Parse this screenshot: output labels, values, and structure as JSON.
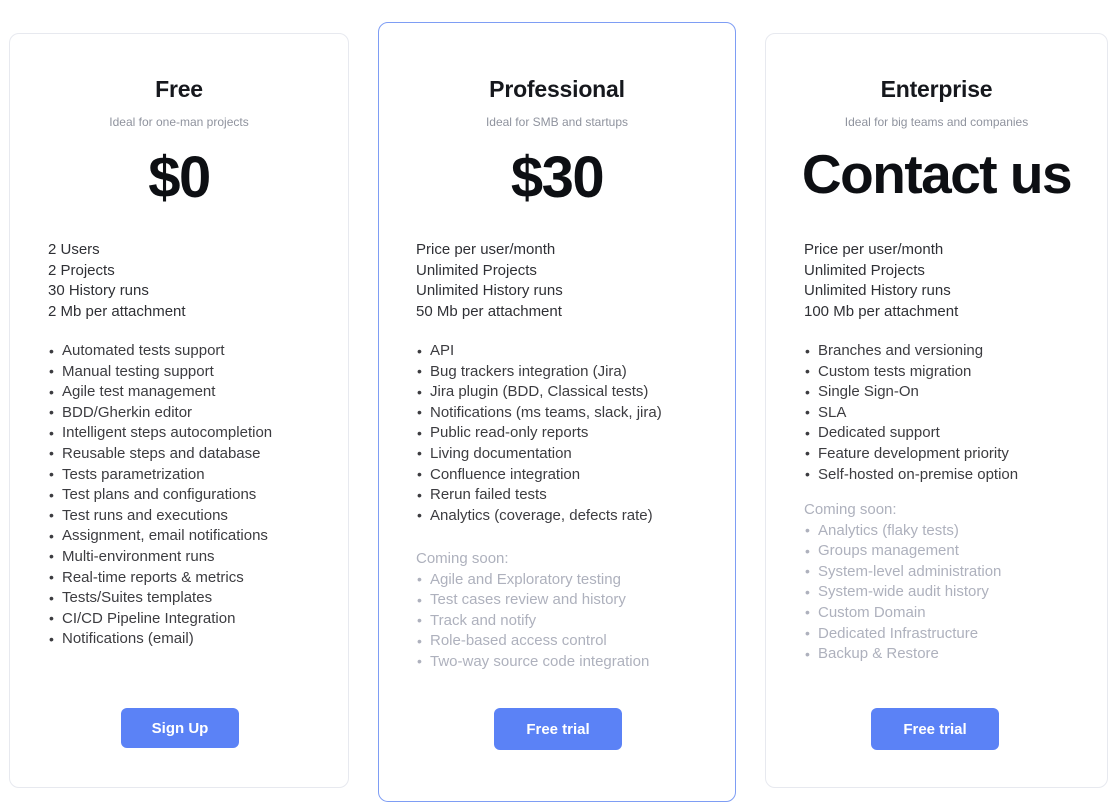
{
  "theme": {
    "page_background": "#ffffff",
    "card_border": "#e7e9ef",
    "highlight_card_border": "#7e9df4",
    "cta_background": "#5b82f6",
    "cta_text": "#ffffff",
    "primary_text": "#16181d",
    "body_text": "#3c3c40",
    "muted_text": "#8f939e",
    "coming_soon_text": "#aeb1bd"
  },
  "plans": [
    {
      "id": "free",
      "name": "Free",
      "tagline": "Ideal for one-man projects",
      "price": "$0",
      "highlighted": false,
      "specs": [
        "2 Users",
        "2 Projects",
        "30 History runs",
        "2 Mb per attachment"
      ],
      "features": [
        "Automated tests support",
        "Manual testing support",
        "Agile test management",
        "BDD/Gherkin editor",
        "Intelligent steps autocompletion",
        "Reusable steps and database",
        "Tests parametrization",
        "Test plans and configurations",
        "Test runs and executions",
        "Assignment, email notifications",
        "Multi-environment runs",
        "Real-time reports & metrics",
        "Tests/Suites templates",
        "CI/CD Pipeline Integration",
        "Notifications (email)"
      ],
      "coming_soon_title": "",
      "coming_soon": [],
      "cta_label": "Sign Up"
    },
    {
      "id": "professional",
      "name": "Professional",
      "tagline": "Ideal for SMB and startups",
      "price": "$30",
      "highlighted": true,
      "specs": [
        "Price per user/month",
        "Unlimited Projects",
        "Unlimited History runs",
        "50 Mb per attachment"
      ],
      "features": [
        "API",
        "Bug trackers integration (Jira)",
        "Jira plugin (BDD, Classical tests)",
        "Notifications (ms teams, slack, jira)",
        "Public read-only reports",
        "Living documentation",
        "Confluence integration",
        "Rerun failed tests",
        "Analytics (coverage, defects rate)"
      ],
      "coming_soon_title": "Coming soon:",
      "coming_soon": [
        "Agile and Exploratory testing",
        "Test cases review and history",
        "Track and notify",
        "Role-based access control",
        "Two-way source code integration"
      ],
      "cta_label": "Free trial"
    },
    {
      "id": "enterprise",
      "name": "Enterprise",
      "tagline": "Ideal for big teams and companies",
      "price": "Contact us",
      "highlighted": false,
      "specs": [
        "Price per user/month",
        "Unlimited Projects",
        "Unlimited History runs",
        "100 Mb per attachment"
      ],
      "features": [
        "Branches and versioning",
        "Custom tests migration",
        "Single Sign-On",
        "SLA",
        "Dedicated support",
        "Feature development priority",
        "Self-hosted on-premise option"
      ],
      "coming_soon_title": "Coming soon:",
      "coming_soon": [
        "Analytics (flaky tests)",
        "Groups management",
        "System-level administration",
        "System-wide audit history",
        "Custom Domain",
        "Dedicated Infrastructure",
        "Backup & Restore"
      ],
      "cta_label": "Free trial"
    }
  ]
}
